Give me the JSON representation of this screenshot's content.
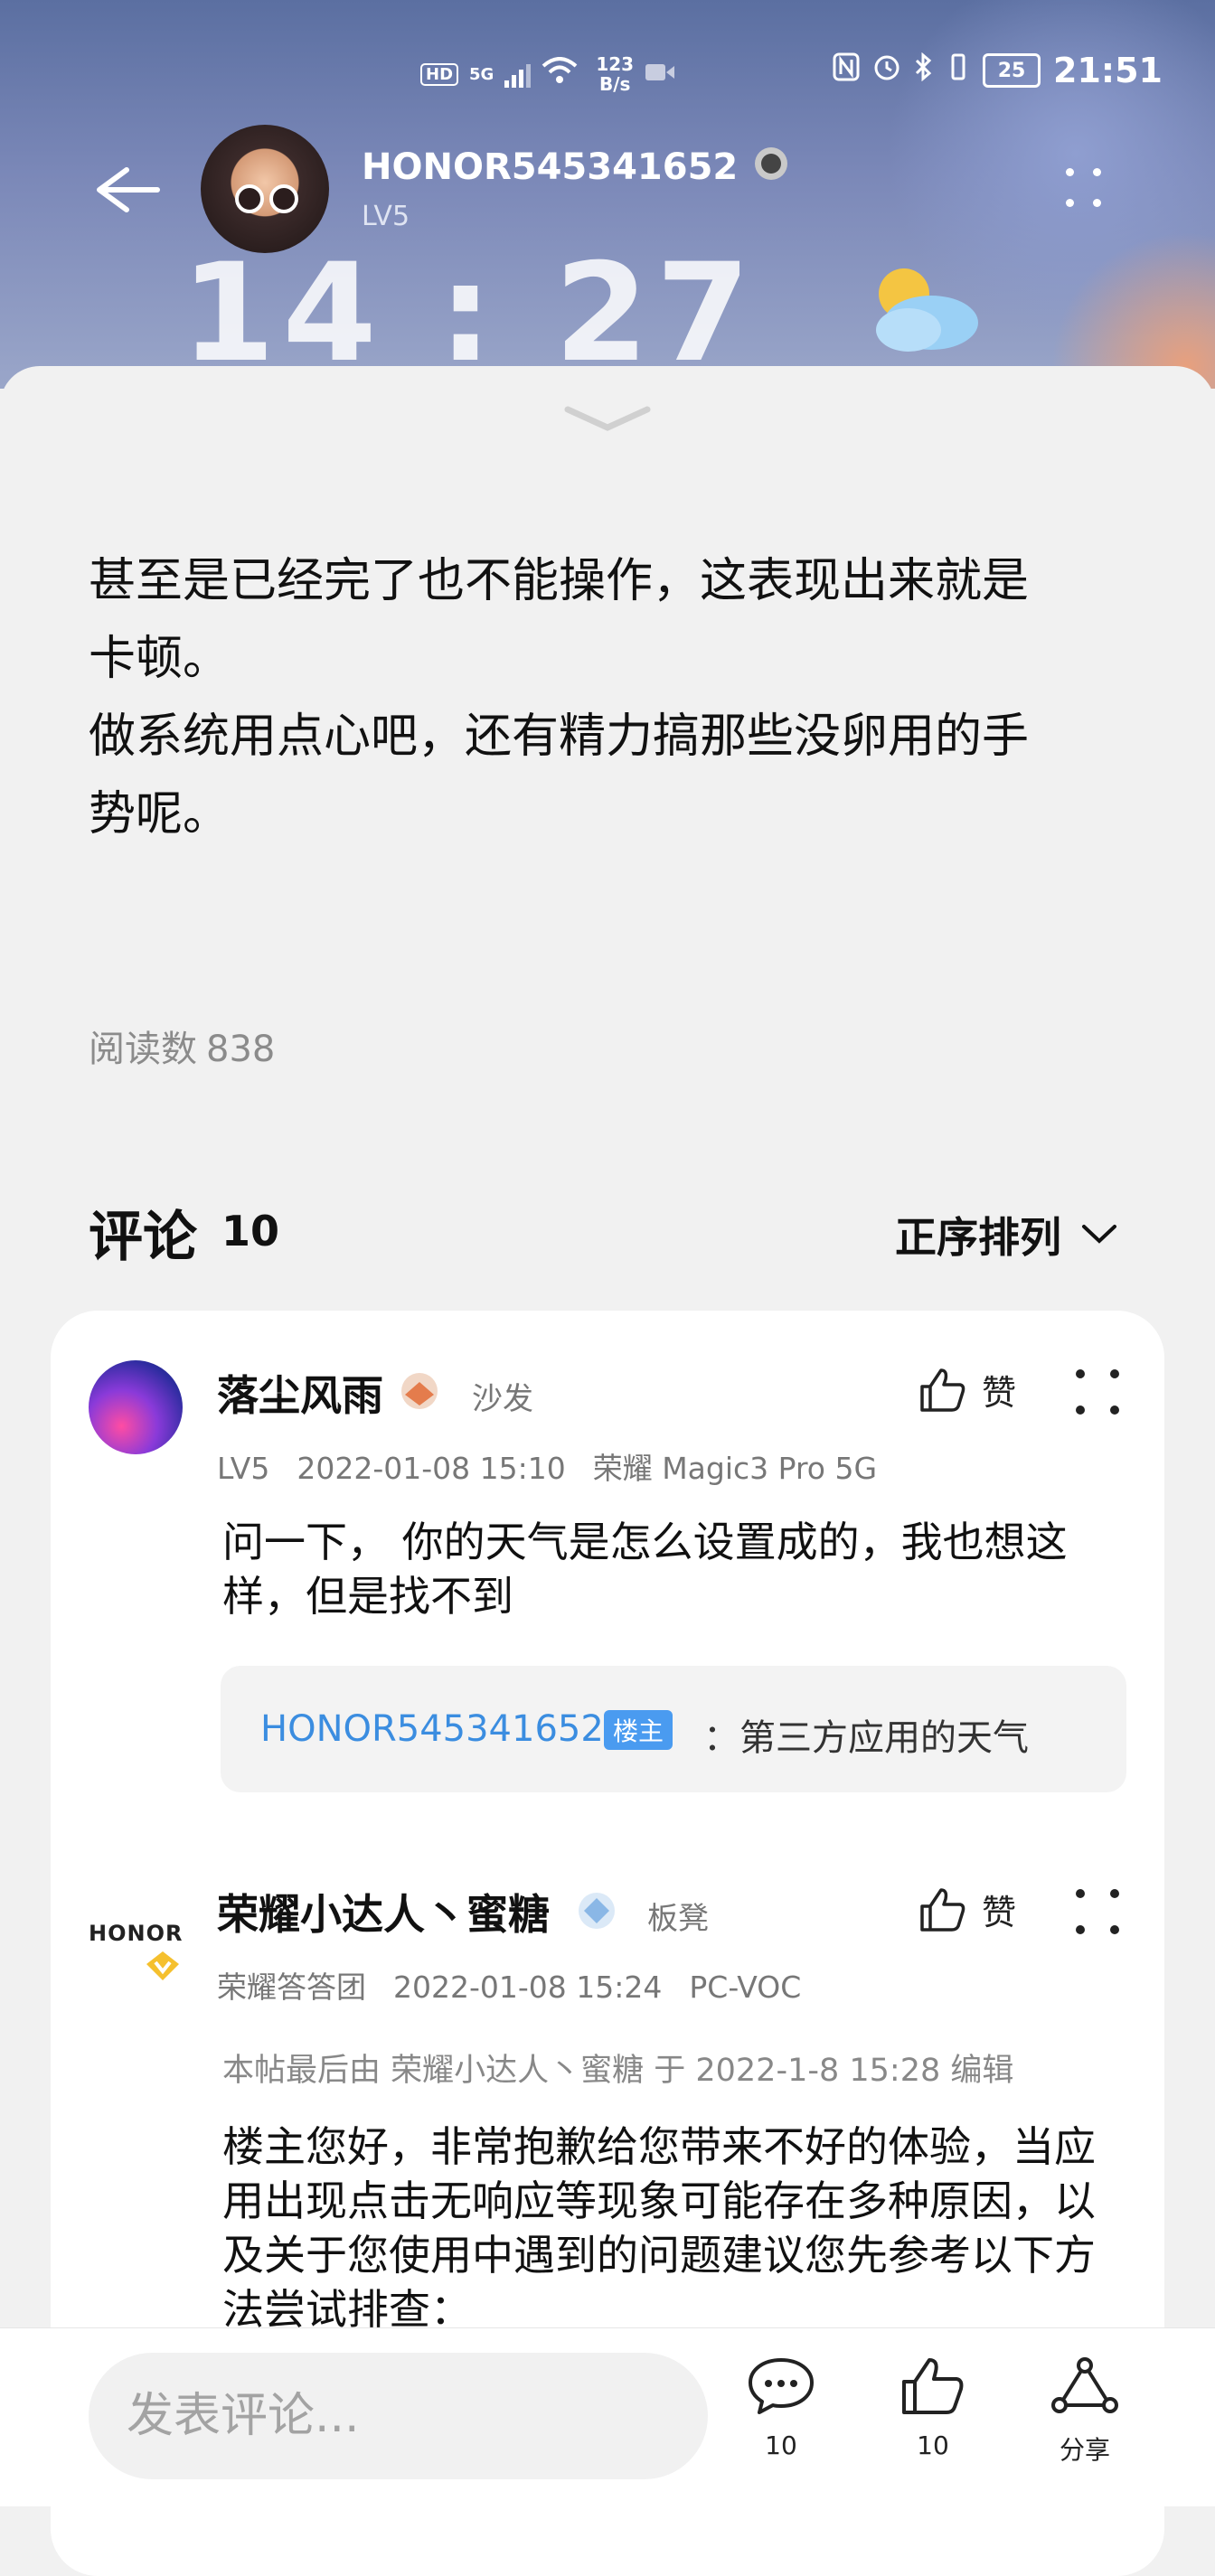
{
  "status_bar": {
    "hd": "HD",
    "net": "5G",
    "net2": "6",
    "speed_value": "123",
    "speed_unit": "B/s",
    "battery": "25",
    "time": "21:51"
  },
  "header": {
    "username": "HONOR545341652",
    "level": "LV5",
    "wallpaper_clock": "14 : 27"
  },
  "post": {
    "text": "甚至是已经完了也不能操作，这表现出来就是\n卡顿。\n做系统用点心吧，还有精力搞那些没卵用的手\n势呢。",
    "reads_label": "阅读数",
    "reads_count": "838"
  },
  "comments": {
    "title": "评论",
    "count": "10",
    "sort_label": "正序排列",
    "items": [
      {
        "name": "落尘风雨",
        "tag": "沙发",
        "level": "LV5",
        "time": "2022-01-08 15:10",
        "device": "荣耀 Magic3 Pro 5G",
        "like_label": "赞",
        "text": "问一下， 你的天气是怎么设置成的，我也想这样，但是找不到",
        "reply": {
          "user": "HONOR545341652",
          "badge": "楼主",
          "text": "：第三方应用的天气"
        }
      },
      {
        "name": "荣耀小达人丶蜜糖",
        "tag": "板凳",
        "level": "荣耀答答团",
        "time": "2022-01-08 15:24",
        "device": "PC-VOC",
        "like_label": "赞",
        "avatar_text": "HONOR",
        "edit_note": "本帖最后由 荣耀小达人丶蜜糖 于 2022-1-8 15:28 编辑",
        "text": "楼主您好，非常抱歉给您带来不好的体验，当应用出现点击无响应等现象可能存在多种原因，以及关于您使用中遇到的问题建议您先参考以下方法尝试排查："
      }
    ]
  },
  "bottom_bar": {
    "input_placeholder": "发表评论...",
    "comment_count": "10",
    "like_count": "10",
    "share_label": "分享"
  }
}
